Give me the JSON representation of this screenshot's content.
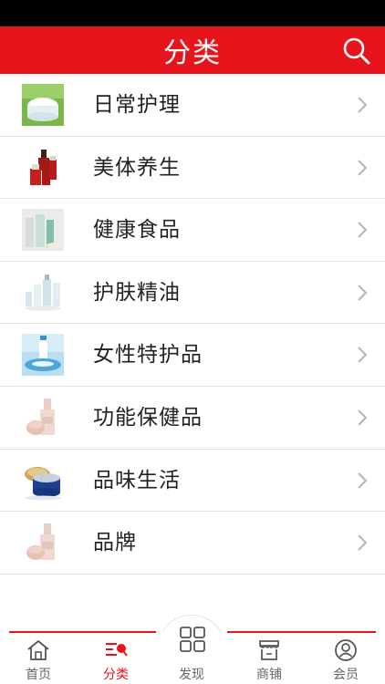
{
  "header": {
    "title": "分类"
  },
  "categories": [
    {
      "label": "日常护理",
      "thumb": "cream-jar-thumbnail"
    },
    {
      "label": "美体养生",
      "thumb": "red-bottles-thumbnail"
    },
    {
      "label": "健康食品",
      "thumb": "tubes-thumbnail"
    },
    {
      "label": "护肤精油",
      "thumb": "white-bottles-thumbnail"
    },
    {
      "label": "女性特护品",
      "thumb": "water-splash-thumbnail"
    },
    {
      "label": "功能保健品",
      "thumb": "foundation-bottle-thumbnail"
    },
    {
      "label": "品味生活",
      "thumb": "blue-jar-thumbnail"
    },
    {
      "label": "品牌",
      "thumb": "foundation-bottle-thumbnail"
    }
  ],
  "tabbar": {
    "home": "首页",
    "category": "分类",
    "discover": "发现",
    "shop": "商铺",
    "member": "会员"
  },
  "colors": {
    "accent": "#e8141b",
    "text": "#222222",
    "tab_text": "#666666"
  }
}
